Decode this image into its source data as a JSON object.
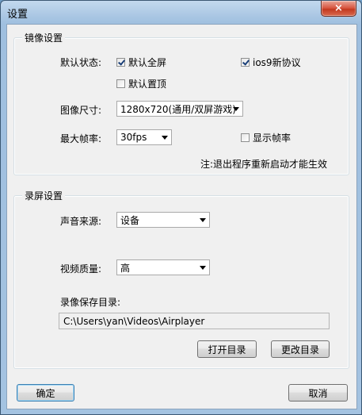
{
  "window": {
    "title": "设置",
    "close_label": "×"
  },
  "mirror_group": {
    "title": "镜像设置",
    "default_state_label": "默认状态:",
    "fullscreen_label": "默认全屏",
    "fullscreen_checked": true,
    "ios9_label": "ios9新协议",
    "ios9_checked": true,
    "ontop_label": "默认置顶",
    "ontop_checked": false,
    "image_size_label": "图像尺寸:",
    "image_size_value": "1280x720(通用/双屏游戏)",
    "max_fps_label": "最大帧率:",
    "max_fps_value": "30fps",
    "show_fps_label": "显示帧率",
    "show_fps_checked": false,
    "note": "注:退出程序重新启动才能生效"
  },
  "record_group": {
    "title": "录屏设置",
    "audio_source_label": "声音来源:",
    "audio_source_value": "设备",
    "video_quality_label": "视频质量:",
    "video_quality_value": "高",
    "save_dir_label": "录像保存目录:",
    "save_dir_value": "C:\\Users\\yan\\Videos\\Airplayer",
    "open_dir_label": "打开目录",
    "change_dir_label": "更改目录"
  },
  "footer": {
    "ok_label": "确定",
    "cancel_label": "取消"
  }
}
